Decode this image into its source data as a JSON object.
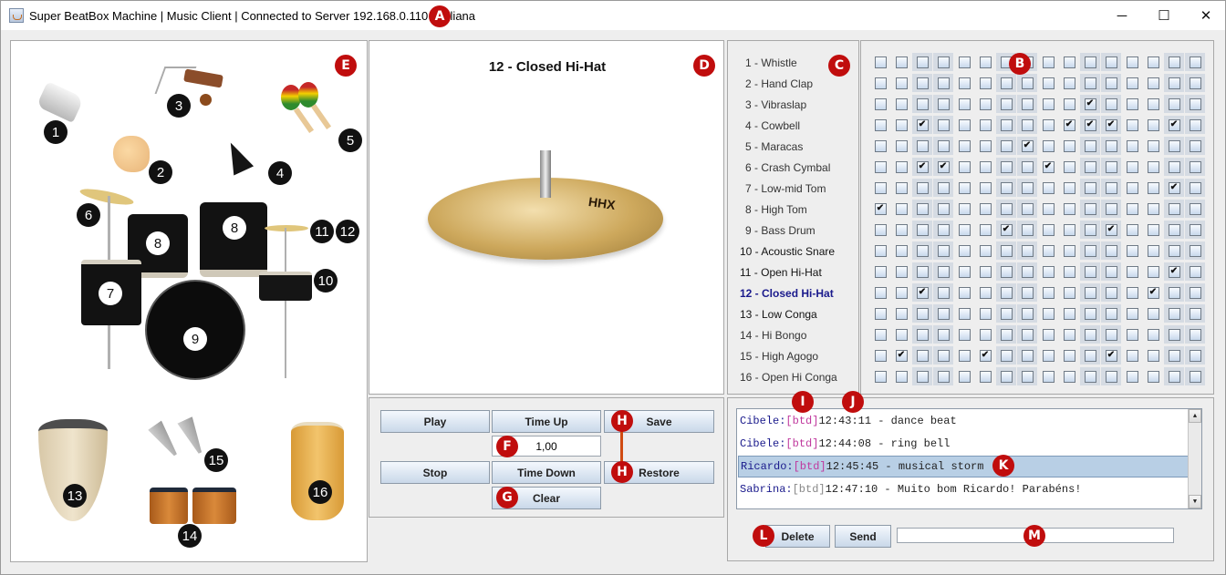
{
  "window": {
    "title": "Super BeatBox Machine | Music Client | Connected to Server 192.168.0.110 | Juliana",
    "controls": [
      "minimize",
      "maximize",
      "close"
    ],
    "minimize_glyph": "─",
    "maximize_glyph": "☐",
    "close_glyph": "✕"
  },
  "annotations": {
    "A": "A",
    "B": "B",
    "C": "C",
    "D": "D",
    "E": "E",
    "F": "F",
    "G": "G",
    "H": "H",
    "I": "I",
    "J": "J",
    "K": "K",
    "L": "L",
    "M": "M"
  },
  "instrument_map": {
    "numbers": [
      "1",
      "2",
      "3",
      "4",
      "5",
      "6",
      "7",
      "8",
      "8",
      "9",
      "10",
      "11",
      "12",
      "13",
      "14",
      "15",
      "16"
    ]
  },
  "preview": {
    "title": "12 - Closed Hi-Hat",
    "image": "closed-hi-hat-cymbal"
  },
  "instruments": [
    {
      "label": "1 - Whistle",
      "style": "normal"
    },
    {
      "label": "2 - Hand Clap",
      "style": "normal"
    },
    {
      "label": "3 - Vibraslap",
      "style": "normal"
    },
    {
      "label": "4 - Cowbell",
      "style": "normal"
    },
    {
      "label": "5 - Maracas",
      "style": "normal"
    },
    {
      "label": "6 - Crash Cymbal",
      "style": "normal"
    },
    {
      "label": "7 - Low-mid Tom",
      "style": "normal"
    },
    {
      "label": "8 - High Tom",
      "style": "normal"
    },
    {
      "label": "9 - Bass Drum",
      "style": "normal"
    },
    {
      "label": "10 - Acoustic Snare",
      "style": "dark"
    },
    {
      "label": "11 - Open Hi-Hat",
      "style": "dark"
    },
    {
      "label": "12 - Closed Hi-Hat",
      "style": "selected"
    },
    {
      "label": "13 - Low Conga",
      "style": "dark"
    },
    {
      "label": "14 - Hi Bongo",
      "style": "normal"
    },
    {
      "label": "15 - High Agogo",
      "style": "normal"
    },
    {
      "label": "16 - Open Hi Conga",
      "style": "normal"
    }
  ],
  "beat_grid": {
    "columns": 16,
    "shaded_columns": [
      3,
      4,
      7,
      8,
      11,
      12,
      15,
      16
    ],
    "check_glyph": "✔",
    "rows": [
      [
        0,
        0,
        0,
        0,
        0,
        0,
        0,
        0,
        0,
        0,
        0,
        0,
        0,
        0,
        0,
        0
      ],
      [
        0,
        0,
        0,
        0,
        0,
        0,
        0,
        0,
        0,
        0,
        0,
        0,
        0,
        0,
        0,
        0
      ],
      [
        0,
        0,
        0,
        0,
        0,
        0,
        0,
        0,
        0,
        0,
        1,
        0,
        0,
        0,
        0,
        0
      ],
      [
        0,
        0,
        1,
        0,
        0,
        0,
        0,
        0,
        0,
        1,
        1,
        1,
        0,
        0,
        1,
        0
      ],
      [
        0,
        0,
        0,
        0,
        0,
        0,
        0,
        1,
        0,
        0,
        0,
        0,
        0,
        0,
        0,
        0
      ],
      [
        0,
        0,
        1,
        1,
        0,
        0,
        0,
        0,
        1,
        0,
        0,
        0,
        0,
        0,
        0,
        0
      ],
      [
        0,
        0,
        0,
        0,
        0,
        0,
        0,
        0,
        0,
        0,
        0,
        0,
        0,
        0,
        1,
        0
      ],
      [
        1,
        0,
        0,
        0,
        0,
        0,
        0,
        0,
        0,
        0,
        0,
        0,
        0,
        0,
        0,
        0
      ],
      [
        0,
        0,
        0,
        0,
        0,
        0,
        1,
        0,
        0,
        0,
        0,
        1,
        0,
        0,
        0,
        0
      ],
      [
        0,
        0,
        0,
        0,
        0,
        0,
        0,
        0,
        0,
        0,
        0,
        0,
        0,
        0,
        0,
        0
      ],
      [
        0,
        0,
        0,
        0,
        0,
        0,
        0,
        0,
        0,
        0,
        0,
        0,
        0,
        0,
        1,
        0
      ],
      [
        0,
        0,
        1,
        0,
        0,
        0,
        0,
        0,
        0,
        0,
        0,
        0,
        0,
        1,
        0,
        0
      ],
      [
        0,
        0,
        0,
        0,
        0,
        0,
        0,
        0,
        0,
        0,
        0,
        0,
        0,
        0,
        0,
        0
      ],
      [
        0,
        0,
        0,
        0,
        0,
        0,
        0,
        0,
        0,
        0,
        0,
        0,
        0,
        0,
        0,
        0
      ],
      [
        0,
        1,
        0,
        0,
        0,
        1,
        0,
        0,
        0,
        0,
        0,
        1,
        0,
        0,
        0,
        0
      ],
      [
        0,
        0,
        0,
        0,
        0,
        0,
        0,
        0,
        0,
        0,
        0,
        0,
        0,
        0,
        0,
        0
      ]
    ]
  },
  "controls": {
    "play": "Play",
    "stop": "Stop",
    "time_up": "Time Up",
    "time_down": "Time Down",
    "tempo_value": "1,00",
    "clear": "Clear",
    "save": "Save",
    "restore": "Restore"
  },
  "chat": {
    "messages": [
      {
        "user": "Cibele:",
        "tag": "[btd]",
        "tag_style": "pink",
        "text": "12:43:11 - dance beat",
        "selected": false
      },
      {
        "user": "Cibele:",
        "tag": "[btd]",
        "tag_style": "pink",
        "text": "12:44:08 - ring bell",
        "selected": false
      },
      {
        "user": "Ricardo:",
        "tag": "[btd]",
        "tag_style": "pink",
        "text": "12:45:45 - musical storm",
        "selected": true
      },
      {
        "user": "Sabrina:",
        "tag": "[btd]",
        "tag_style": "gray",
        "text": "12:47:10 - Muito bom Ricardo! Parabéns!",
        "selected": false
      }
    ],
    "scroll_up": "▲",
    "scroll_down": "▼",
    "delete": "Delete",
    "send": "Send",
    "input_value": ""
  }
}
